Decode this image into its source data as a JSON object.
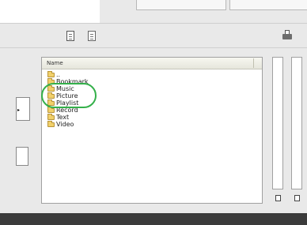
{
  "list": {
    "header": "Name",
    "items": [
      {
        "name": ".."
      },
      {
        "name": "Bookmark"
      },
      {
        "name": "Music"
      },
      {
        "name": "Picture"
      },
      {
        "name": "Playlist"
      },
      {
        "name": "Record"
      },
      {
        "name": "Text"
      },
      {
        "name": "Video"
      }
    ]
  },
  "colors": {
    "highlight": "#34b04a",
    "folder": "#f1d06a",
    "bottom_bar": "#3b3b3b"
  },
  "icons": [
    "document-icon",
    "document-copy-icon",
    "printer-icon",
    "small-document-icon"
  ]
}
